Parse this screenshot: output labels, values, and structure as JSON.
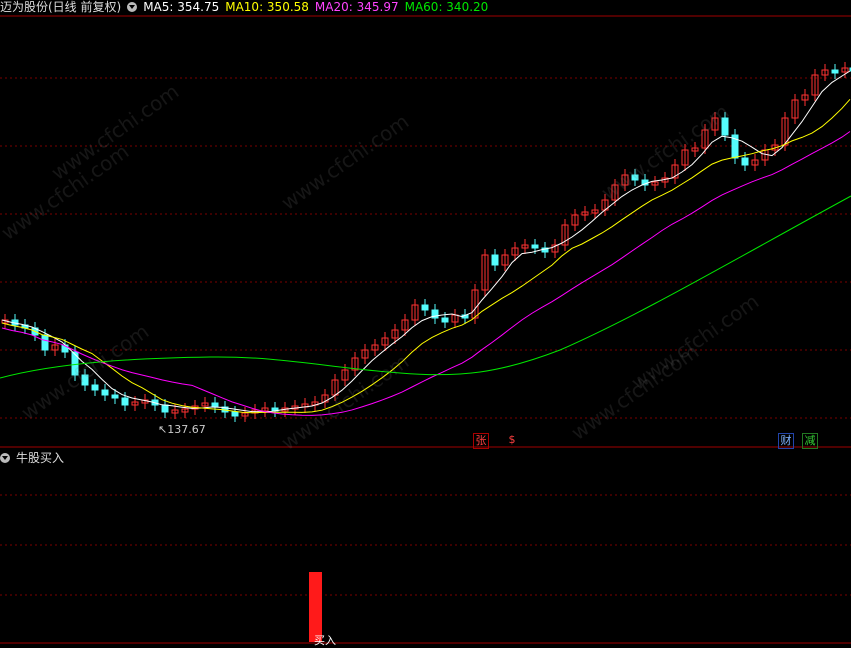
{
  "header": {
    "title": "迈为股份(日线 前复权)",
    "ma5": "MA5: 354.75",
    "ma10": "MA10: 350.58",
    "ma20": "MA20: 345.97",
    "ma60": "MA60: 340.20"
  },
  "colors": {
    "up": "#ff3232",
    "down": "#54fcfc",
    "ma5": "#ffffff",
    "ma10": "#ffff00",
    "ma20": "#ff00ff",
    "ma60": "#00e600",
    "grid": "#7a0000"
  },
  "low_label": "137.67",
  "badges": [
    {
      "text": "张",
      "color": "#ff4040"
    },
    {
      "text": "$",
      "color": "#ff4040"
    },
    {
      "text": "财",
      "color": "#7fb2ff"
    },
    {
      "text": "减",
      "color": "#33cc33"
    }
  ],
  "indicator": {
    "title": "牛股买入",
    "buy_label": "买入"
  },
  "watermark": "www.cfchi.com",
  "chart_data": {
    "type": "candlestick",
    "title": "迈为股份(日线 前复权)",
    "low_marker": 137.67,
    "ma_last": {
      "MA5": 354.75,
      "MA10": 350.58,
      "MA20": 345.97,
      "MA60": 340.2
    }
  }
}
